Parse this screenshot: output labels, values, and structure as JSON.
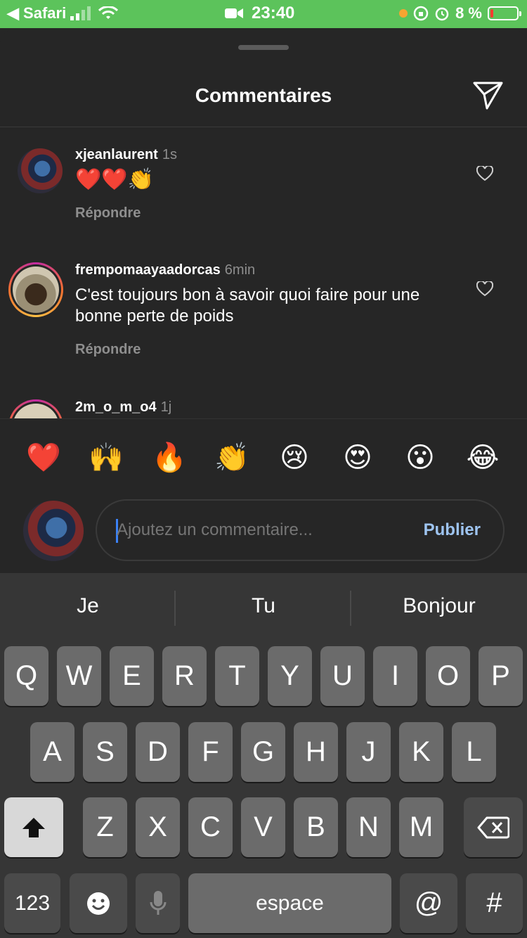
{
  "status_bar": {
    "back_app": "◀ Safari",
    "time": "23:40",
    "battery": "8 %"
  },
  "sheet": {
    "title": "Commentaires"
  },
  "comments": [
    {
      "username": "xjeanlaurent",
      "time": "1s",
      "text": "❤️❤️👏",
      "reply": "Répondre"
    },
    {
      "username": "frempomaayaadorcas",
      "time": "6min",
      "text": "C'est toujours bon à savoir quoi faire pour une bonne perte de poids",
      "reply": "Répondre"
    },
    {
      "username": "2m_o_m_o4",
      "time": "1j"
    }
  ],
  "emoji_bar": [
    "❤️",
    "🙌",
    "🔥",
    "👏",
    "😢",
    "😍",
    "😮",
    "😂"
  ],
  "composer": {
    "placeholder": "Ajoutez un commentaire...",
    "publish": "Publier"
  },
  "keyboard": {
    "suggestions": [
      "Je",
      "Tu",
      "Bonjour"
    ],
    "row1": [
      "Q",
      "W",
      "E",
      "R",
      "T",
      "Y",
      "U",
      "I",
      "O",
      "P"
    ],
    "row2": [
      "A",
      "S",
      "D",
      "F",
      "G",
      "H",
      "J",
      "K",
      "L"
    ],
    "row3": [
      "Z",
      "X",
      "C",
      "V",
      "B",
      "N",
      "M"
    ],
    "numbers_key": "123",
    "space_key": "espace",
    "at_key": "@",
    "hash_key": "#"
  },
  "colors": {
    "status_bar_bg": "#5cc35b",
    "sheet_bg": "#262626",
    "publish": "#9ec4f0",
    "keyboard_bg": "#363636",
    "key_bg": "#6b6b6b"
  }
}
